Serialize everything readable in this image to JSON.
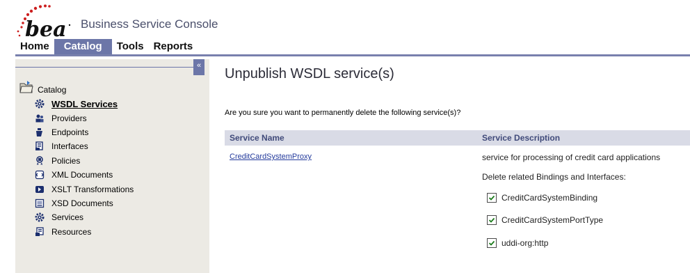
{
  "brand": {
    "logo_text": "bea",
    "app_title": "Business Service Console"
  },
  "nav": {
    "tabs": [
      {
        "label": "Home",
        "active": false
      },
      {
        "label": "Catalog",
        "active": true
      },
      {
        "label": "Tools",
        "active": false
      },
      {
        "label": "Reports",
        "active": false
      }
    ]
  },
  "sidebar": {
    "collapse_label": "«",
    "root_label": "Catalog",
    "items": [
      {
        "label": "WSDL Services",
        "icon": "gear-icon",
        "selected": true
      },
      {
        "label": "Providers",
        "icon": "provider-icon",
        "selected": false
      },
      {
        "label": "Endpoints",
        "icon": "endpoint-icon",
        "selected": false
      },
      {
        "label": "Interfaces",
        "icon": "interface-icon",
        "selected": false
      },
      {
        "label": "Policies",
        "icon": "policy-icon",
        "selected": false
      },
      {
        "label": "XML Documents",
        "icon": "xml-document-icon",
        "selected": false
      },
      {
        "label": "XSLT Transformations",
        "icon": "xslt-transform-icon",
        "selected": false
      },
      {
        "label": "XSD Documents",
        "icon": "xsd-document-icon",
        "selected": false
      },
      {
        "label": "Services",
        "icon": "gear-icon",
        "selected": false
      },
      {
        "label": "Resources",
        "icon": "resource-icon",
        "selected": false
      }
    ]
  },
  "main": {
    "title": "Unpublish WSDL service(s)",
    "question": "Are you sure you want to permanently delete the following service(s)?",
    "table": {
      "headers": [
        "Service Name",
        "Service Description"
      ],
      "row": {
        "name": "CreditCardSystemProxy",
        "description": "service for processing of credit card applications"
      }
    },
    "delete_related_label": "Delete related Bindings and Interfaces:",
    "related": [
      {
        "label": "CreditCardSystemBinding",
        "checked": true
      },
      {
        "label": "CreditCardSystemPortType",
        "checked": true
      },
      {
        "label": "uddi-org:http",
        "checked": true
      }
    ]
  },
  "colors": {
    "nav_active": "#6c76a8",
    "sidebar_bg": "#eceae4",
    "table_header_bg": "#d9dbe6",
    "link": "#233a9c",
    "logo_red": "#cc1f1f"
  }
}
